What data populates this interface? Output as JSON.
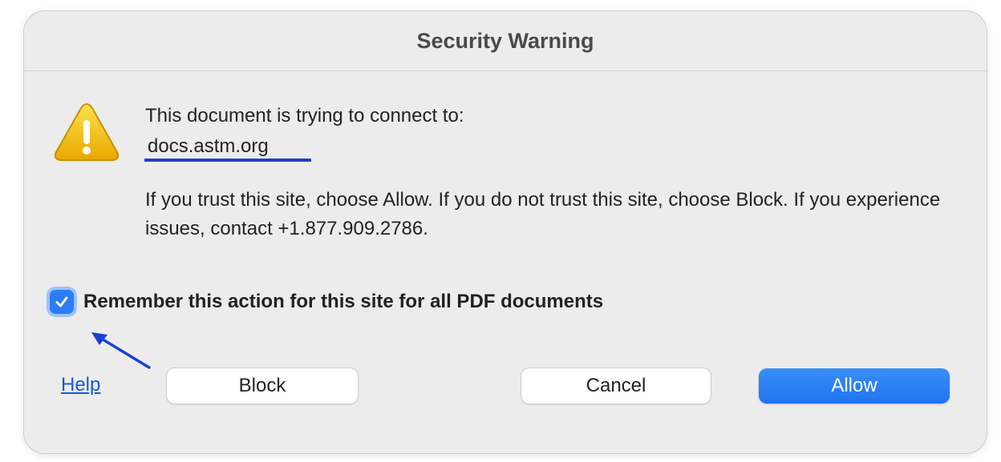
{
  "dialog": {
    "title": "Security Warning",
    "message": "This document is trying to connect to:",
    "site": "docs.astm.org",
    "info": "If you trust this site, choose Allow. If you do not trust this site, choose Block. If you experience issues, contact +1.877.909.2786.",
    "remember": {
      "label": "Remember this action for this site for all PDF documents",
      "checked": true
    },
    "help_label": "Help",
    "buttons": {
      "block": "Block",
      "cancel": "Cancel",
      "allow": "Allow"
    }
  },
  "icons": {
    "warning": "warning-triangle-icon",
    "checkbox": "checkmark-icon",
    "annotation": "arrow-icon"
  },
  "colors": {
    "accent": "#1f73f0",
    "warning": "#f2b705",
    "link": "#1a57d6",
    "annotation": "#1b3fd6"
  }
}
